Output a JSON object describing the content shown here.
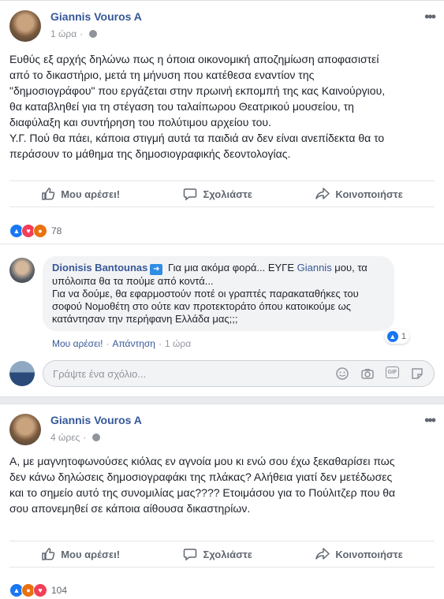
{
  "post1": {
    "author": "Giannis Vouros A",
    "time": "1 ώρα",
    "text": "Ευθύς εξ αρχής δηλώνω πως η όποια οικονομική αποζημίωση αποφασιστεί\nαπό το δικαστήριο, μετά τη μήνυση που κατέθεσα εναντίον της\n\"δημοσιογράφου\" που εργάζεται στην πρωινή εκπομπή της κας Καινούργιου,\nθα καταβληθεί για τη στέγαση του ταλαίπωρου Θεατρικού μουσείου, τη\nδιαφύλαξη και συντήρηση του πολύτιμου αρχείου του.\nΥ.Γ. Πού θα πάει, κάποια στιγμή αυτά τα παιδιά αν δεν είναι ανεπίδεκτα θα το\nπεράσουν το μάθημα της δημοσιογραφικής δεοντολογίας.",
    "actions": {
      "like": "Μου αρέσει!",
      "comment": "Σχολιάστε",
      "share": "Κοινοποιήστε"
    },
    "reactions_count": "78"
  },
  "comment": {
    "author": "Dionisis Bantounas",
    "text_before_mention": " Για μια ακόμα φορά... ΕΥΓΕ ",
    "mention": "Giannis",
    "text_after_mention": " μου, τα υπόλοιπα θα τα πούμε από κοντά...\nΓια να δούμε, θα εφαρμοστούν ποτέ οι γραπτές παρακαταθήκες του σοφού Νομοθέτη στο ούτε καν προτεκτοράτο όπου κατοικούμε ως κατάντησαν την περήφανη Ελλάδα μας;;;",
    "like": "Μου αρέσει!",
    "reply": "Απάντηση",
    "time": "1 ώρα",
    "separator": "·",
    "like_count": "1"
  },
  "comment_box": {
    "placeholder": "Γράψτε ένα σχόλιο...",
    "gif_label": "GIF"
  },
  "post2": {
    "author": "Giannis Vouros A",
    "time": "4 ώρες",
    "text": "Α, με μαγνητοφωνούσες κιόλας εν αγνοία μου κι ενώ σου έχω ξεκαθαρίσει πως\nδεν κάνω δηλώσεις δημοσιογραφάκι της πλάκας? Αλήθεια γιατί δεν μετέδωσες\nκαι το σημείο αυτό της συνομιλίας μας???? Ετοιμάσου για το Πούλιτζερ που θα\nσου απονεμηθεί σε κάποια αίθουσα δικαστηρίων.",
    "actions": {
      "like": "Μου αρέσει!",
      "comment": "Σχολιάστε",
      "share": "Κοινοποιήστε"
    },
    "reactions_count": "104"
  },
  "colors": {
    "link": "#365899",
    "background": "#e9ebee",
    "like_blue": "#1877f2"
  },
  "icons": [
    "thumbs-up-icon",
    "speech-bubble-icon",
    "share-arrow-icon",
    "globe-icon",
    "more-dots-icon",
    "emoji-icon",
    "camera-icon",
    "gif-icon",
    "sticker-icon"
  ]
}
